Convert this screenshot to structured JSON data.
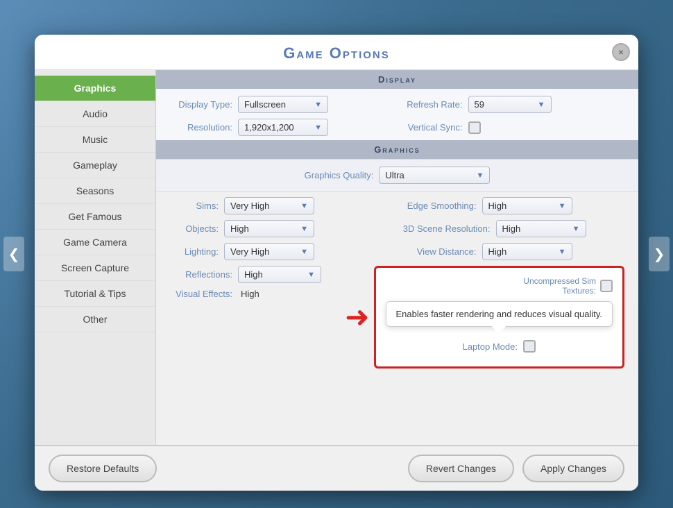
{
  "dialog": {
    "title": "Game Options",
    "close_label": "×"
  },
  "nav": {
    "left_arrow": "❮",
    "right_arrow": "❯"
  },
  "sidebar": {
    "items": [
      {
        "id": "graphics",
        "label": "Graphics",
        "active": true
      },
      {
        "id": "audio",
        "label": "Audio",
        "active": false
      },
      {
        "id": "music",
        "label": "Music",
        "active": false
      },
      {
        "id": "gameplay",
        "label": "Gameplay",
        "active": false
      },
      {
        "id": "seasons",
        "label": "Seasons",
        "active": false
      },
      {
        "id": "get-famous",
        "label": "Get Famous",
        "active": false
      },
      {
        "id": "game-camera",
        "label": "Game Camera",
        "active": false
      },
      {
        "id": "screen-capture",
        "label": "Screen Capture",
        "active": false
      },
      {
        "id": "tutorial-tips",
        "label": "Tutorial & Tips",
        "active": false
      },
      {
        "id": "other",
        "label": "Other",
        "active": false
      }
    ]
  },
  "display_section": {
    "header": "Display",
    "display_type_label": "Display Type:",
    "display_type_value": "Fullscreen",
    "refresh_rate_label": "Refresh Rate:",
    "refresh_rate_value": "59",
    "resolution_label": "Resolution:",
    "resolution_value": "1,920x1,200",
    "vertical_sync_label": "Vertical Sync:"
  },
  "graphics_section": {
    "header": "Graphics",
    "quality_label": "Graphics Quality:",
    "quality_value": "Ultra",
    "sims_label": "Sims:",
    "sims_value": "Very High",
    "edge_smoothing_label": "Edge Smoothing:",
    "edge_smoothing_value": "High",
    "objects_label": "Objects:",
    "objects_value": "High",
    "scene_resolution_label": "3D Scene Resolution:",
    "scene_resolution_value": "High",
    "lighting_label": "Lighting:",
    "lighting_value": "Very High",
    "view_distance_label": "View Distance:",
    "view_distance_value": "High",
    "reflections_label": "Reflections:",
    "reflections_value": "High",
    "uncompressed_label": "Uncompressed Sim Textures:",
    "visual_effects_label": "Visual Effects:",
    "visual_effects_value": "High",
    "laptop_mode_label": "Laptop Mode:"
  },
  "tooltip": {
    "text": "Enables faster rendering and reduces visual quality."
  },
  "footer": {
    "restore_label": "Restore Defaults",
    "revert_label": "Revert Changes",
    "apply_label": "Apply Changes"
  }
}
